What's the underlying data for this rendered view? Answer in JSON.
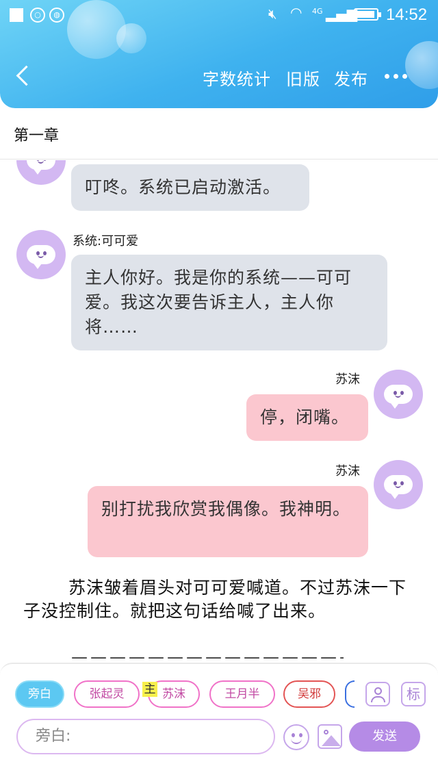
{
  "status_bar": {
    "time": "14:52",
    "network": "4G"
  },
  "header": {
    "back_label": "",
    "actions": [
      "字数统计",
      "旧版",
      "发布"
    ],
    "more_label": "more"
  },
  "chapter": {
    "title": "第一章"
  },
  "messages": [
    {
      "side": "left",
      "speaker": "",
      "text": "叮咚。系统已启动激活。"
    },
    {
      "side": "left",
      "speaker": "系统:可可爱",
      "text": "主人你好。我是你的系统——可可爱。我这次要告诉主人，主人你将……"
    },
    {
      "side": "right",
      "speaker": "苏沫",
      "text": "停，闭嘴。"
    },
    {
      "side": "right",
      "speaker": "苏沫",
      "text": "别打扰我欣赏我偶像。我神明。"
    }
  ],
  "narration": "苏沫皱着眉头对可可爱喊道。不过苏沫一下子没控制住。就把这句话给喊了出来。",
  "divider_text": "——————————————————",
  "role_chips": [
    {
      "label": "旁白",
      "style": "selected"
    },
    {
      "label": "张起灵",
      "style": "pink"
    },
    {
      "label": "苏沫",
      "style": "pink",
      "badge": "主"
    },
    {
      "label": "王月半",
      "style": "pink"
    },
    {
      "label": "吴邪",
      "style": "red"
    }
  ],
  "tools": {
    "mark_label": "标"
  },
  "composer": {
    "placeholder": "旁白:",
    "send_label": "发送"
  },
  "colors": {
    "header_gradient_start": "#6fd4f6",
    "header_gradient_end": "#2f9ee9",
    "left_bubble": "#dfe3ea",
    "right_bubble": "#fbc7cf",
    "avatar": "#d3b8f2",
    "send_button": "#b58be6",
    "selected_chip": "#5cc8f2"
  }
}
